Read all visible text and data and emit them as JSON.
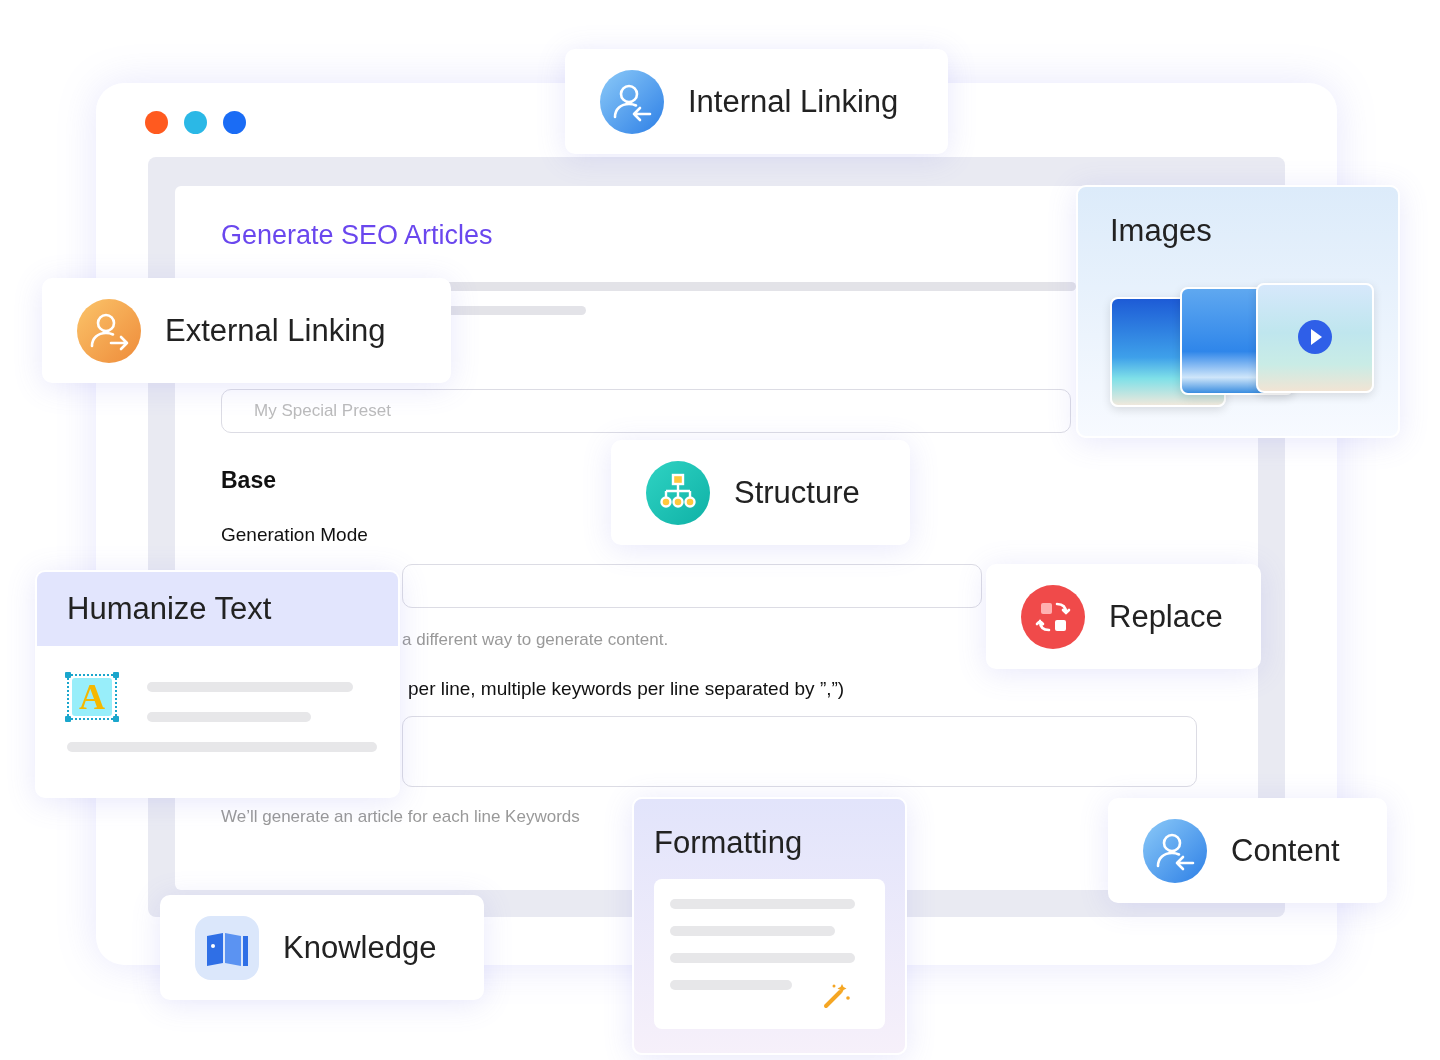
{
  "window": {
    "controls": [
      {
        "color": "#ff5a1f"
      },
      {
        "color": "#2bb8e6"
      },
      {
        "color": "#1a6cf5"
      }
    ]
  },
  "form": {
    "title": "Generate SEO Articles",
    "preset_field": {
      "placeholder": "My Special Preset"
    },
    "section_title": "Base",
    "generation_mode_label": "Generation Mode",
    "mode_hint": "a different way to generate content.",
    "keywords_label": "per line, multiple keywords per line separated by ”,”)",
    "keywords_hint": "We’ll generate an article for each line Keywords"
  },
  "internal_linking_card": {
    "title": "Internal Linking"
  },
  "images_card": {
    "title": "Images"
  },
  "external_linking_card": {
    "title": "External Linking"
  },
  "structure_card": {
    "title": "Structure"
  },
  "humanize_card": {
    "title": "Humanize Text",
    "icon_letter": "A"
  },
  "replace_card": {
    "title": "Replace"
  },
  "formatting_card": {
    "title": "Formatting"
  },
  "content_card": {
    "title": "Content"
  },
  "knowledge_card": {
    "title": "Knowledge"
  }
}
